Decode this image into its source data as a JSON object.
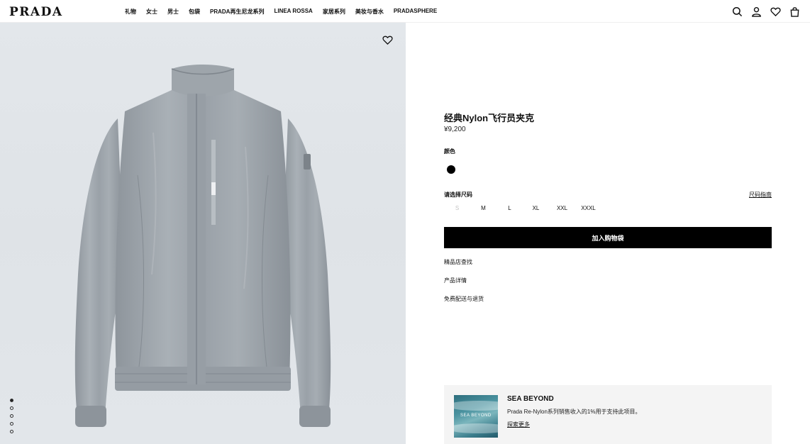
{
  "header": {
    "logo": "PRADA",
    "nav": [
      "礼物",
      "女士",
      "男士",
      "包袋",
      "PRADA再生尼龙系列",
      "LINEA ROSSA",
      "家居系列",
      "美妆与香水",
      "PRADASPHERE"
    ],
    "icons": [
      "search-icon",
      "account-icon",
      "wishlist-icon",
      "bag-icon"
    ]
  },
  "gallery": {
    "image": "grey-nylon-jacket",
    "total_images": 5,
    "active_index": 1
  },
  "product": {
    "title": "经典Nylon飞行员夹克",
    "price": "¥9,200",
    "color_label": "颜色",
    "selected_color": "#000000",
    "size_label": "请选择尺码",
    "size_guide": "尺码指南",
    "sizes": [
      {
        "label": "S",
        "available": false
      },
      {
        "label": "M",
        "available": true
      },
      {
        "label": "L",
        "available": true
      },
      {
        "label": "XL",
        "available": true
      },
      {
        "label": "XXL",
        "available": true
      },
      {
        "label": "XXXL",
        "available": true
      }
    ],
    "add_to_bag": "加入购物袋",
    "links": [
      "精品店查找",
      "产品详情",
      "免费配送与退货"
    ]
  },
  "sea_beyond": {
    "image_text": "SEA BEYOND",
    "title": "SEA BEYOND",
    "description": "Prada Re-Nylon系列销售收入的1%用于支持此项目。",
    "link": "探索更多"
  }
}
